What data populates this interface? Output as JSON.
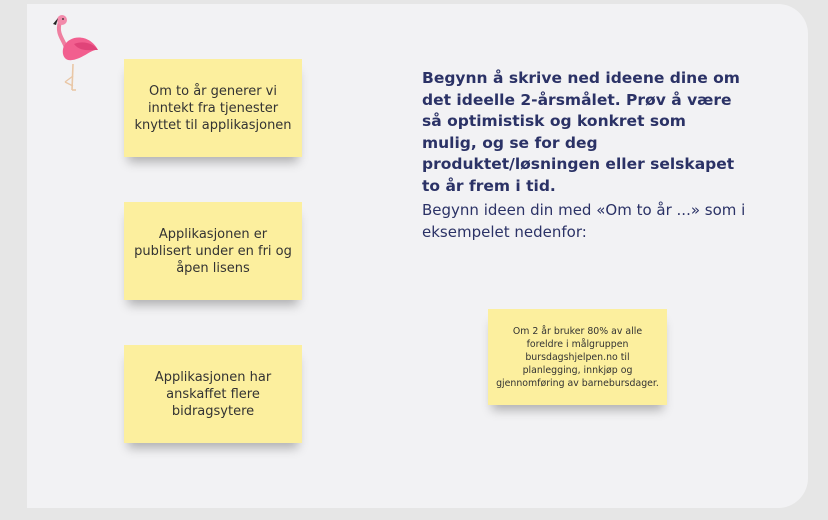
{
  "notes": [
    {
      "text": "Om to år generer vi inntekt fra tjenester knyttet til applikasjonen"
    },
    {
      "text": "Applikasjonen er publisert under en fri og åpen lisens"
    },
    {
      "text": "Applikasjonen har anskaffet flere bidragsytere"
    }
  ],
  "instructions": {
    "heading": "Begynn å skrive ned ideene dine om det ideelle 2-årsmålet. Prøv å være så optimistisk og konkret som mulig, og se for deg produktet/løsningen eller selskapet to år frem i tid.",
    "body": "Begynn ideen din med «Om to år ...» som i eksempelet nedenfor:"
  },
  "example_note": {
    "text": "Om 2 år bruker 80% av alle foreldre i målgruppen bursdagshjelpen.no til planlegging, innkjøp og gjennomføring av barnebursdager."
  },
  "icons": {
    "mascot": "flamingo-icon"
  },
  "colors": {
    "note": "#fcef9e",
    "text_heading": "#2b3266",
    "board": "#f2f2f4"
  }
}
